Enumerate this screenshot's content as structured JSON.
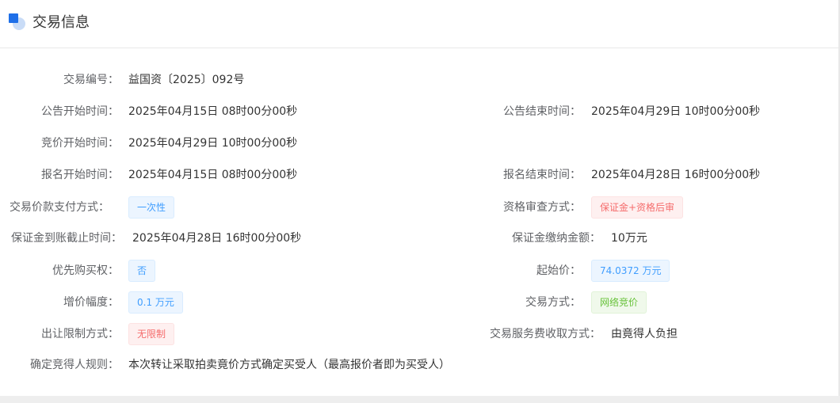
{
  "header": {
    "title": "交易信息",
    "icon": "section-icon"
  },
  "info": {
    "trade_no": {
      "label": "交易编号：",
      "value": "益国资〔2025〕092号"
    },
    "notice_start": {
      "label": "公告开始时间：",
      "value": "2025年04月15日 08时00分00秒"
    },
    "notice_end": {
      "label": "公告结束时间：",
      "value": "2025年04月29日 10时00分00秒"
    },
    "bid_start": {
      "label": "竞价开始时间：",
      "value": "2025年04月29日 10时00分00秒"
    },
    "signup_start": {
      "label": "报名开始时间：",
      "value": "2025年04月15日 08时00分00秒"
    },
    "signup_end": {
      "label": "报名结束时间：",
      "value": "2025年04月28日 16时00分00秒"
    },
    "payment_method": {
      "label": "交易价款支付方式：",
      "value": "一次性"
    },
    "qualification_method": {
      "label": "资格审查方式：",
      "value": "保证金+资格后审"
    },
    "deposit_deadline": {
      "label": "保证金到账截止时间：",
      "value": "2025年04月28日 16时00分00秒"
    },
    "deposit_amount": {
      "label": "保证金缴纳金额：",
      "value": "10万元"
    },
    "preemptive_right": {
      "label": "优先购买权：",
      "value": "否"
    },
    "starting_price": {
      "label": "起始价：",
      "value": "74.0372 万元"
    },
    "increment": {
      "label": "增价幅度：",
      "value": "0.1 万元"
    },
    "trade_method": {
      "label": "交易方式：",
      "value": "网络竞价"
    },
    "transfer_limit": {
      "label": "出让限制方式：",
      "value": "无限制"
    },
    "service_fee": {
      "label": "交易服务费收取方式：",
      "value": "由竟得人负担"
    },
    "winner_rule": {
      "label": "确定竞得人规则：",
      "value": "本次转让采取拍卖竟价方式确定买受人（最高报价者即为买受人）"
    }
  },
  "colors": {
    "tag_blue": "#409eff",
    "tag_red": "#f56c6c",
    "tag_green": "#67c23a",
    "icon_blue": "#1e6fe8"
  }
}
